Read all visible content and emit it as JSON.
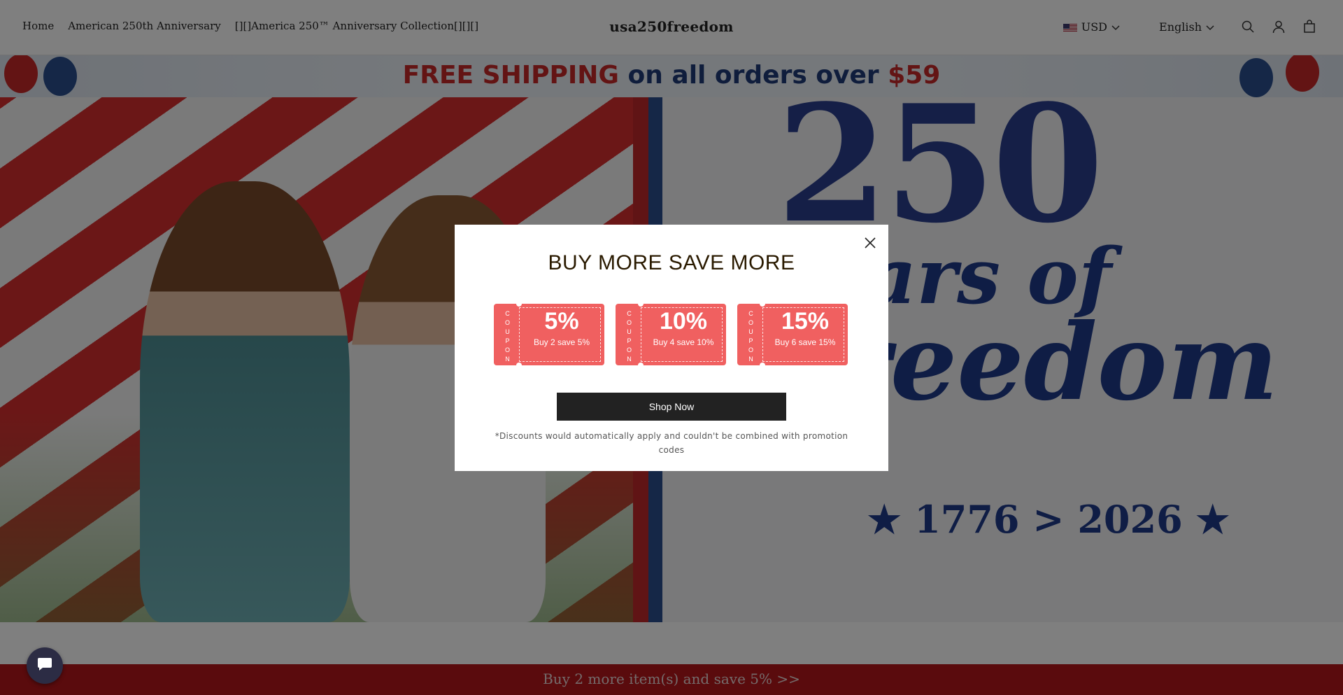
{
  "header": {
    "nav": [
      {
        "label": "Home"
      },
      {
        "label": "American 250th Anniversary"
      },
      {
        "label": "[][]America 250™ Anniversary Collection[][][]"
      }
    ],
    "logo": "usa250freedom",
    "currency": "USD",
    "language": "English",
    "icons": [
      "search-icon",
      "account-icon",
      "cart-icon"
    ]
  },
  "shipping_banner": {
    "part1": "FREE SHIPPING",
    "part2": "on all orders over",
    "part3": "$59"
  },
  "hero": {
    "number": "250",
    "line1": "Years of",
    "line2": "Freedom",
    "dates": "★ 1776 > 2026 ★"
  },
  "modal": {
    "title": "BUY MORE SAVE MORE",
    "coupon_vertical_text": "COUPON",
    "coupons": [
      {
        "percent": "5%",
        "text": "Buy 2 save 5%"
      },
      {
        "percent": "10%",
        "text": "Buy 4 save 10%"
      },
      {
        "percent": "15%",
        "text": "Buy 6 save 15%"
      }
    ],
    "button": "Shop Now",
    "disclaimer": "*Discounts would automatically apply and couldn't be combined with promotion codes"
  },
  "bottom_bar": {
    "text": "Buy 2 more item(s) and save 5%  >>"
  },
  "colors": {
    "coupon": "#f06060",
    "bottom_bar": "#b5161b",
    "button": "#222222",
    "title": "#2a1a00"
  }
}
